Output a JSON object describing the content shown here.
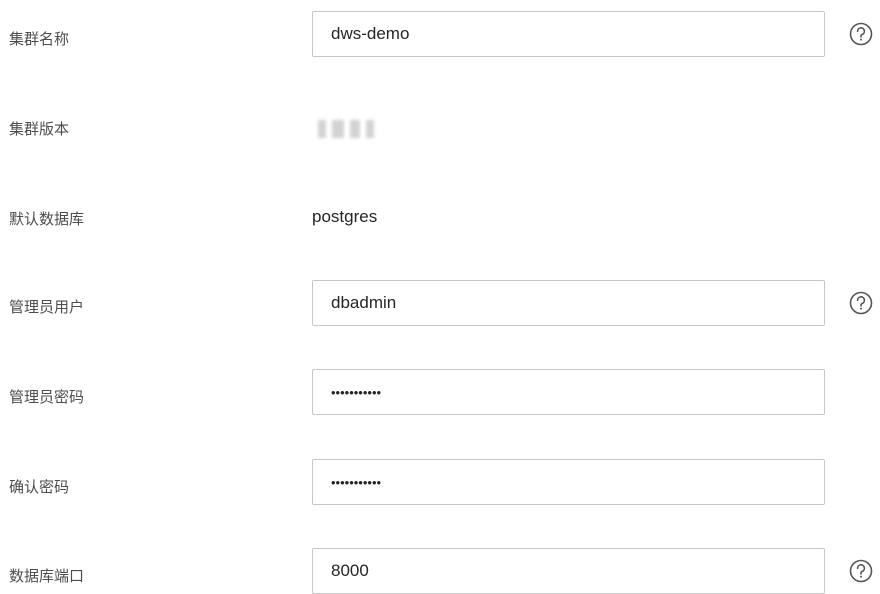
{
  "form": {
    "cluster_name": {
      "label": "集群名称",
      "value": "dws-demo"
    },
    "cluster_version": {
      "label": "集群版本"
    },
    "default_database": {
      "label": "默认数据库",
      "value": "postgres"
    },
    "admin_user": {
      "label": "管理员用户",
      "value": "dbadmin"
    },
    "admin_password": {
      "label": "管理员密码",
      "masked_value": "•••••••••••"
    },
    "confirm_password": {
      "label": "确认密码",
      "masked_value": "•••••••••••"
    },
    "database_port": {
      "label": "数据库端口",
      "value": "8000"
    }
  },
  "icons": {
    "help": "question-circle-icon"
  },
  "colors": {
    "label": "#4d4d4d",
    "value": "#252525",
    "border": "#c6c6c6",
    "help_icon": "#555555"
  }
}
